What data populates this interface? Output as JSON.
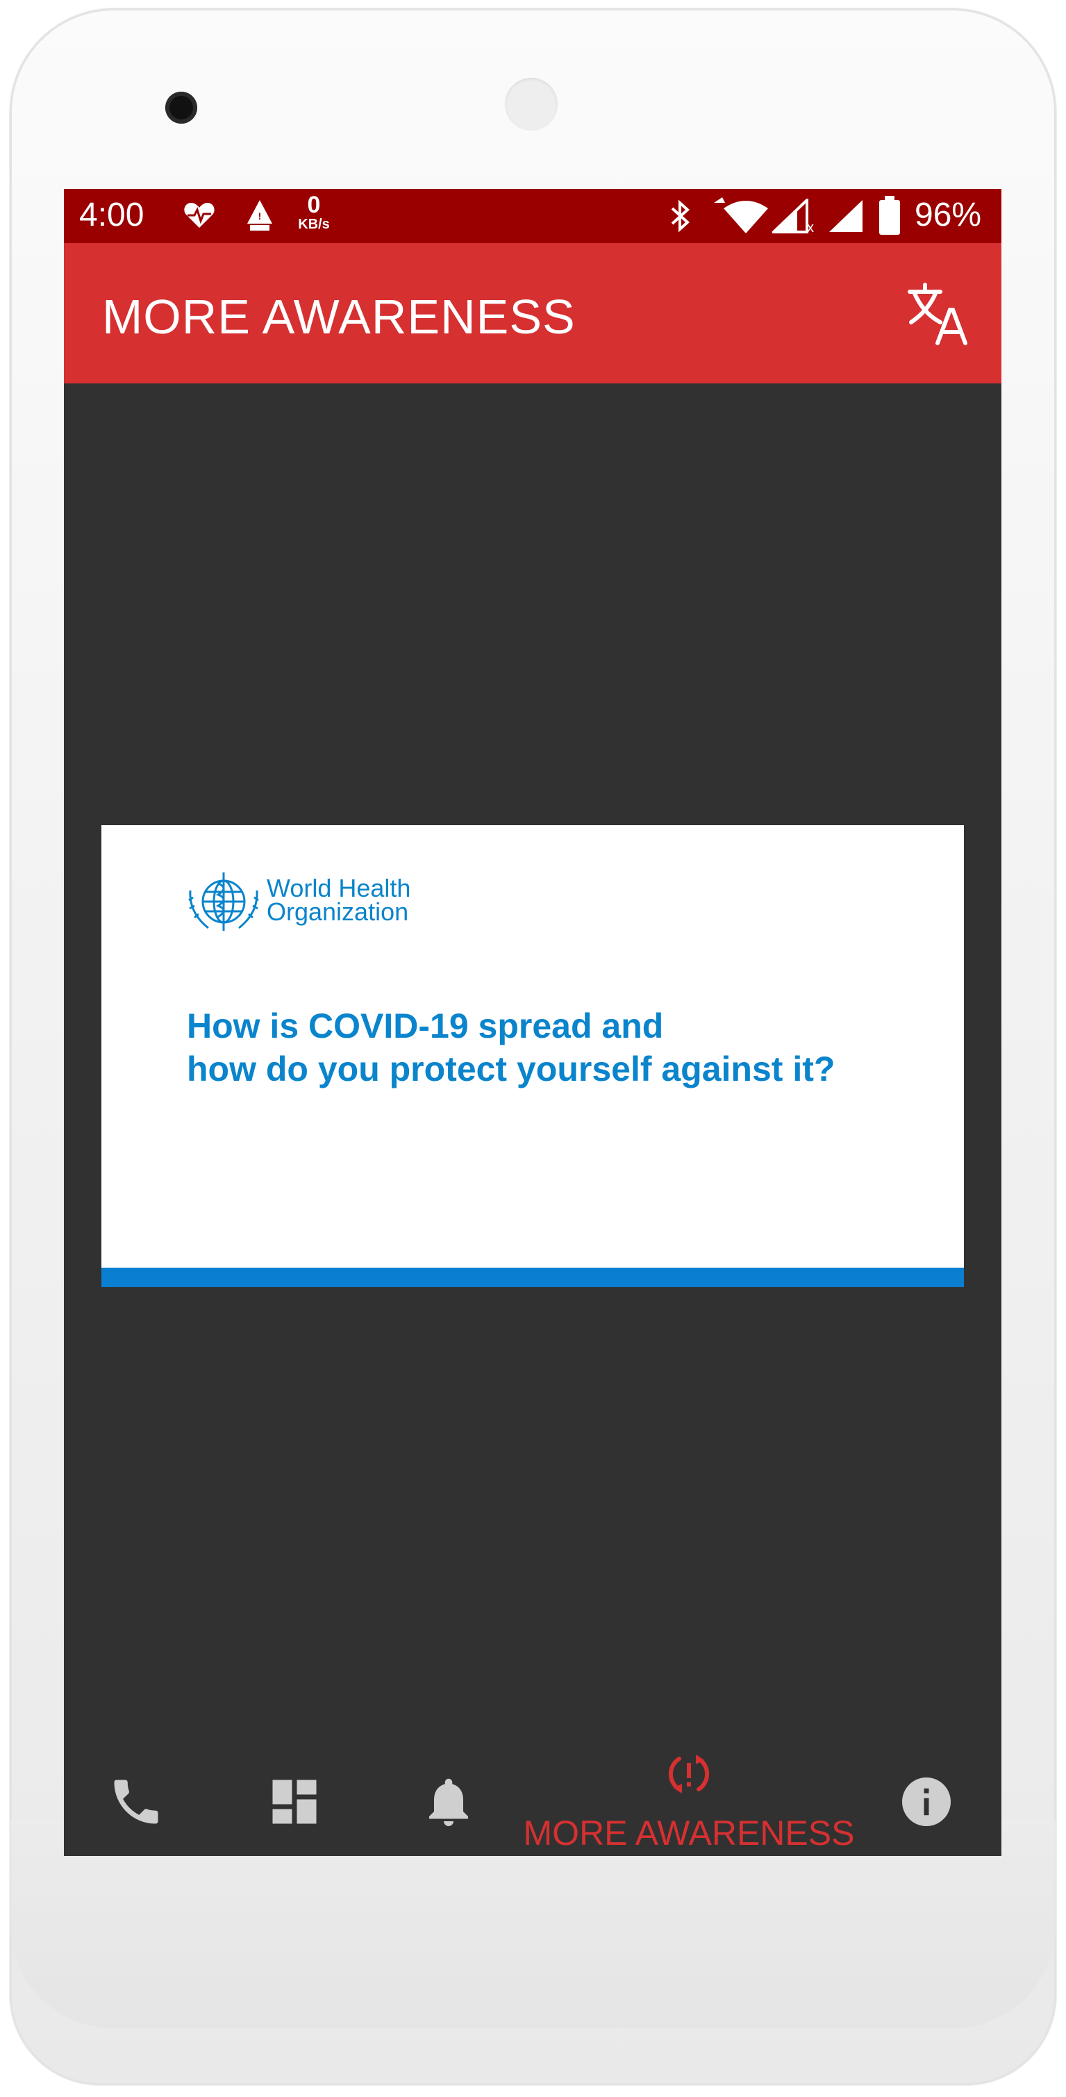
{
  "status_bar": {
    "time": "4:00",
    "speed_value": "0",
    "speed_unit": "KB/s",
    "battery": "96%"
  },
  "app_bar": {
    "title": "MORE AWARENESS",
    "action_icon": "translate-icon"
  },
  "content": {
    "card": {
      "org_name_line1": "World Health",
      "org_name_line2": "Organization",
      "headline_line1": "How is COVID-19 spread and",
      "headline_line2": "how do you protect yourself against it?",
      "accent_color": "#0a84cc"
    }
  },
  "bottom_nav": {
    "items": [
      {
        "icon": "phone-icon"
      },
      {
        "icon": "dashboard-icon"
      },
      {
        "icon": "bell-icon"
      },
      {
        "icon": "awareness-icon",
        "label": "MORE AWARENESS",
        "active": true
      },
      {
        "icon": "info-icon"
      }
    ],
    "active_color": "#d63031"
  },
  "colors": {
    "status_bar": "#9b0000",
    "app_bar": "#d63031",
    "background": "#313131"
  }
}
